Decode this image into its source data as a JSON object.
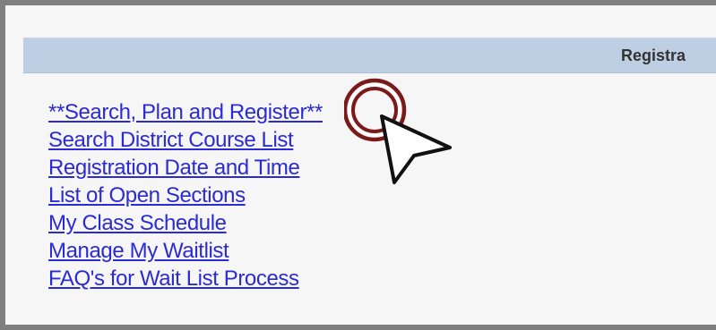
{
  "header": {
    "title": "Registra"
  },
  "links": [
    "**Search, Plan and Register**",
    "Search District Course List",
    "Registration Date and Time",
    "List of Open Sections",
    "My Class Schedule",
    "Manage My Waitlist",
    "FAQ's for Wait List Process"
  ],
  "colors": {
    "link": "#2b2bd4",
    "header_bar": "#bfcfe3",
    "click_ring": "#7a1a1a"
  },
  "icons": {
    "cursor": "mouse-pointer-icon",
    "click_indicator": "click-ring-icon"
  }
}
